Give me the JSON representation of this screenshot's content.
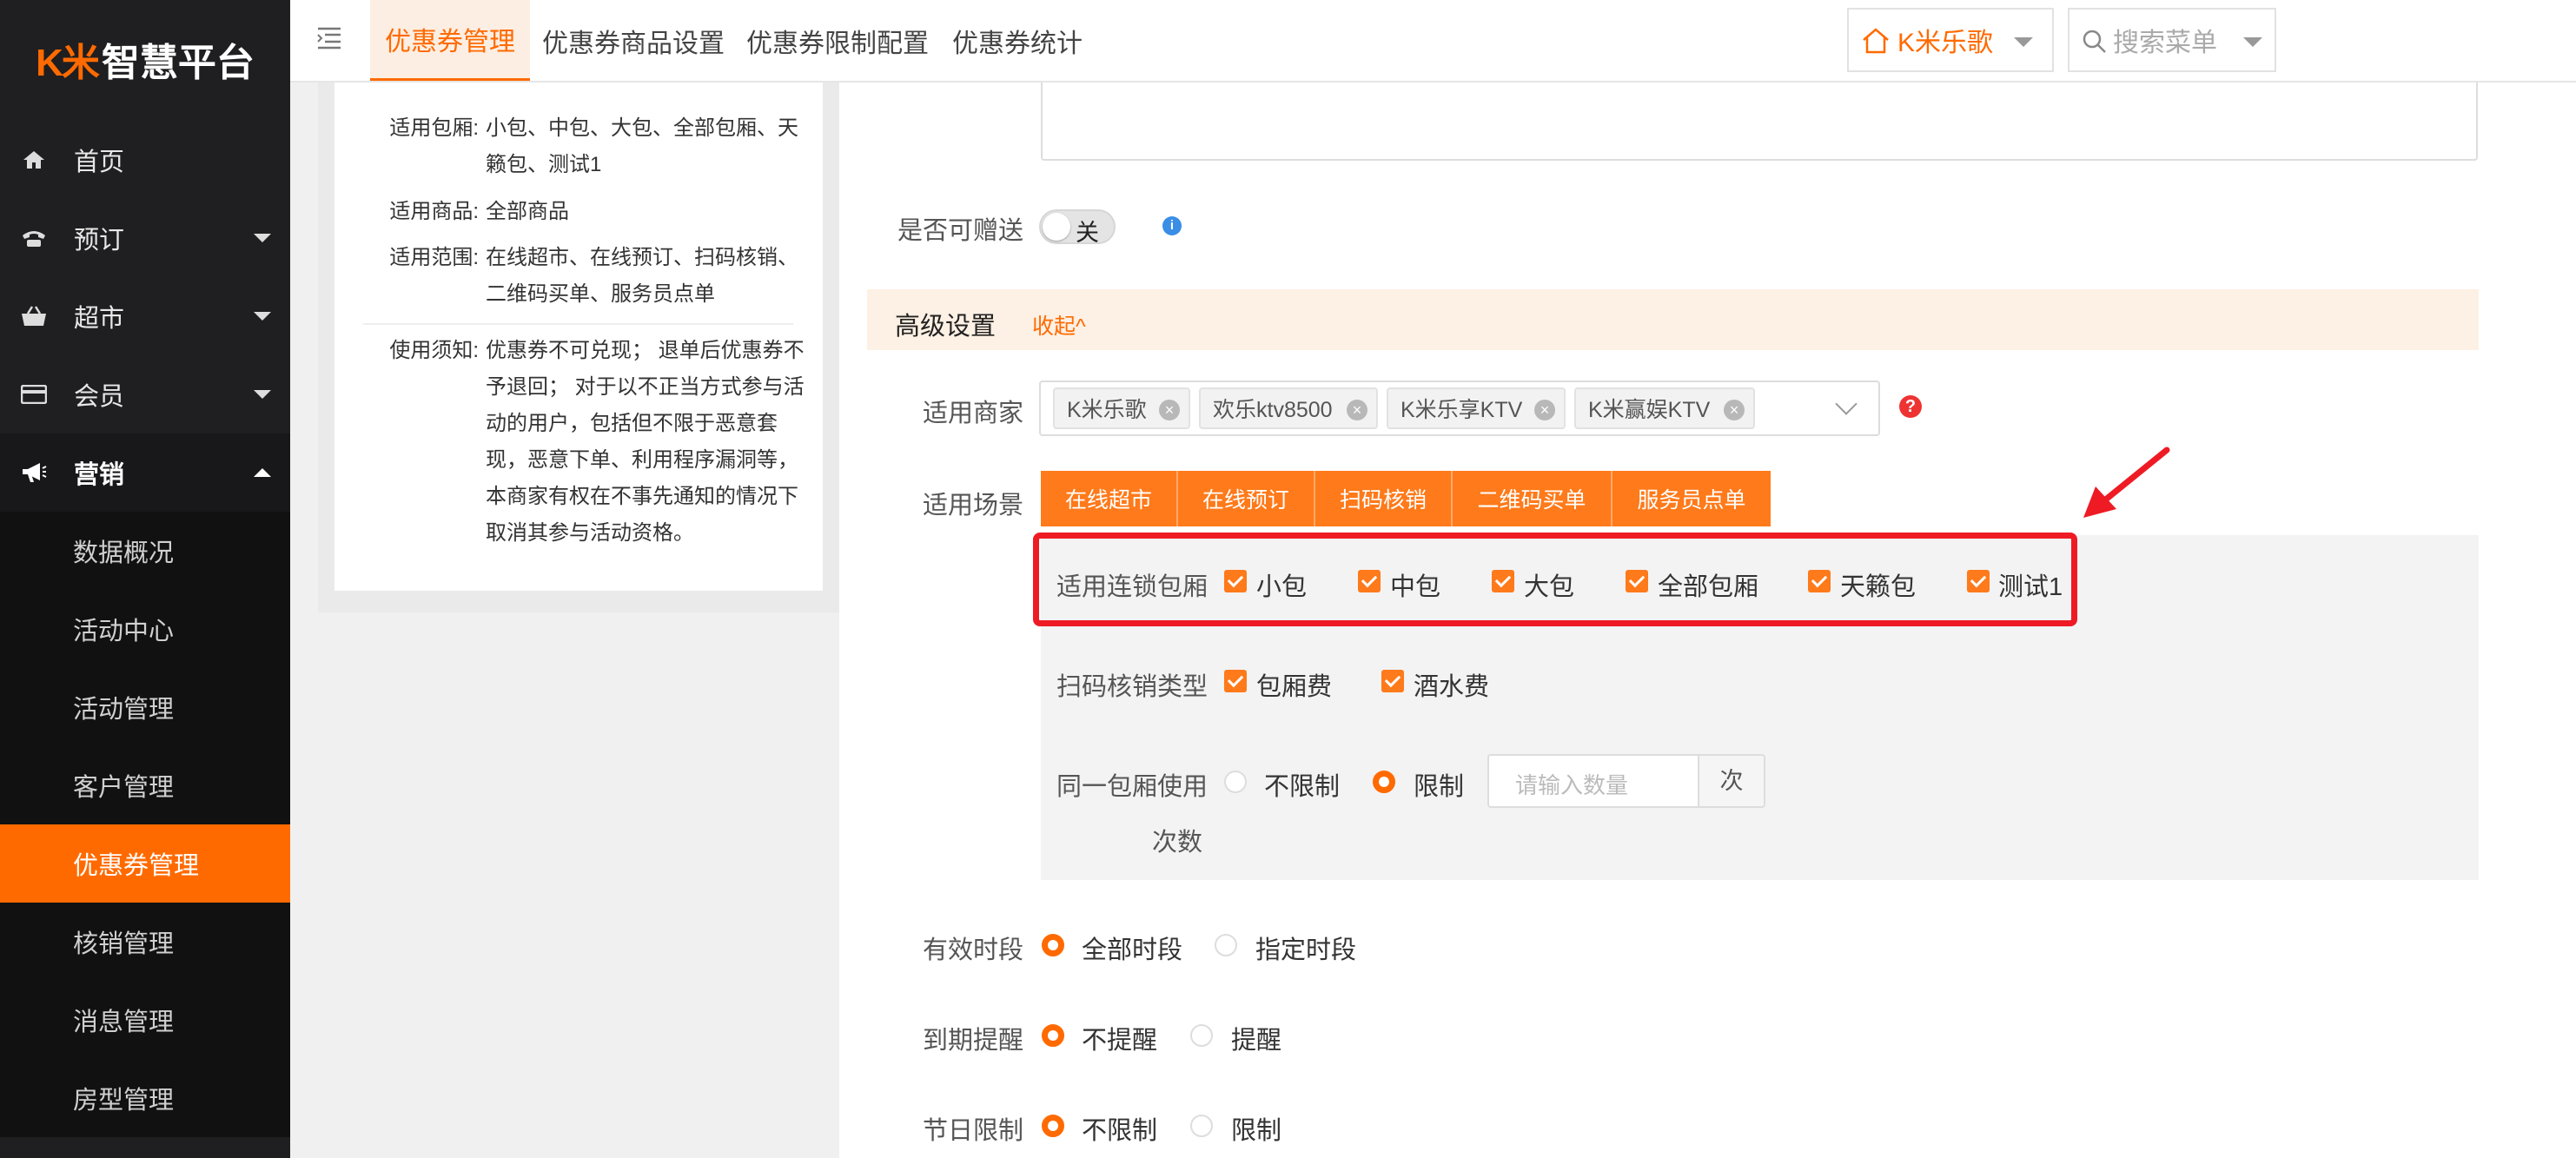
{
  "colors": {
    "accent": "#ff6a00",
    "sidebar_bg": "#1f1f21",
    "highlight": "#ee1b24"
  },
  "logo": {
    "mark": "K米",
    "text": "智慧平台"
  },
  "sidebar": {
    "items": [
      {
        "label": "首页",
        "icon": "home-icon"
      },
      {
        "label": "预订",
        "icon": "phone-icon"
      },
      {
        "label": "超市",
        "icon": "basket-icon"
      },
      {
        "label": "会员",
        "icon": "card-icon"
      },
      {
        "label": "营销",
        "icon": "megaphone-icon"
      }
    ],
    "sub_items": [
      "数据概况",
      "活动中心",
      "活动管理",
      "客户管理",
      "优惠券管理",
      "核销管理",
      "消息管理",
      "房型管理"
    ],
    "active_sub": "优惠券管理"
  },
  "topbar": {
    "tabs": [
      "优惠券管理",
      "优惠券商品设置",
      "优惠券限制配置",
      "优惠券统计"
    ],
    "active_tab": "优惠券管理",
    "store": "K米乐歌",
    "search_placeholder": "搜索菜单"
  },
  "preview": {
    "rooms_label": "适用包厢:",
    "rooms_value": "小包、中包、大包、全部包厢、天籁包、测试1",
    "goods_label": "适用商品:",
    "goods_value": "全部商品",
    "scope_label": "适用范围:",
    "scope_value": "在线超市、在线预订、扫码核销、二维码买单、服务员点单",
    "notice_label": "使用须知:",
    "notice_value": "优惠券不可兑现； 退单后优惠券不予退回； 对于以不正当方式参与活动的用户，包括但不限于恶意套现，恶意下单、利用程序漏洞等，本商家有权在不事先通知的情况下取消其参与活动资格。"
  },
  "form": {
    "gift_label": "是否可赠送",
    "gift_toggle": "关",
    "advanced_title": "高级设置",
    "collapse_label": "收起^",
    "merchant_label": "适用商家",
    "merchants": [
      "K米乐歌",
      "欢乐ktv8500",
      "K米乐享KTV",
      "K米赢娱KTV"
    ],
    "scene_label": "适用场景",
    "scenes": [
      "在线超市",
      "在线预订",
      "扫码核销",
      "二维码买单",
      "服务员点单"
    ],
    "chain_rooms_label": "适用连锁包厢",
    "chain_rooms": [
      "小包",
      "中包",
      "大包",
      "全部包厢",
      "天籁包",
      "测试1"
    ],
    "scan_type_label": "扫码核销类型",
    "scan_types": [
      "包厢费",
      "酒水费"
    ],
    "same_room_label_1": "同一包厢使用",
    "same_room_label_2": "次数",
    "same_room_options": [
      "不限制",
      "限制"
    ],
    "same_room_selected": "限制",
    "qty_placeholder": "请输入数量",
    "qty_unit": "次",
    "valid_period_label": "有效时段",
    "valid_period_options": [
      "全部时段",
      "指定时段"
    ],
    "expire_label": "到期提醒",
    "expire_options": [
      "不提醒",
      "提醒"
    ],
    "holiday_label": "节日限制",
    "holiday_options": [
      "不限制",
      "限制"
    ]
  }
}
